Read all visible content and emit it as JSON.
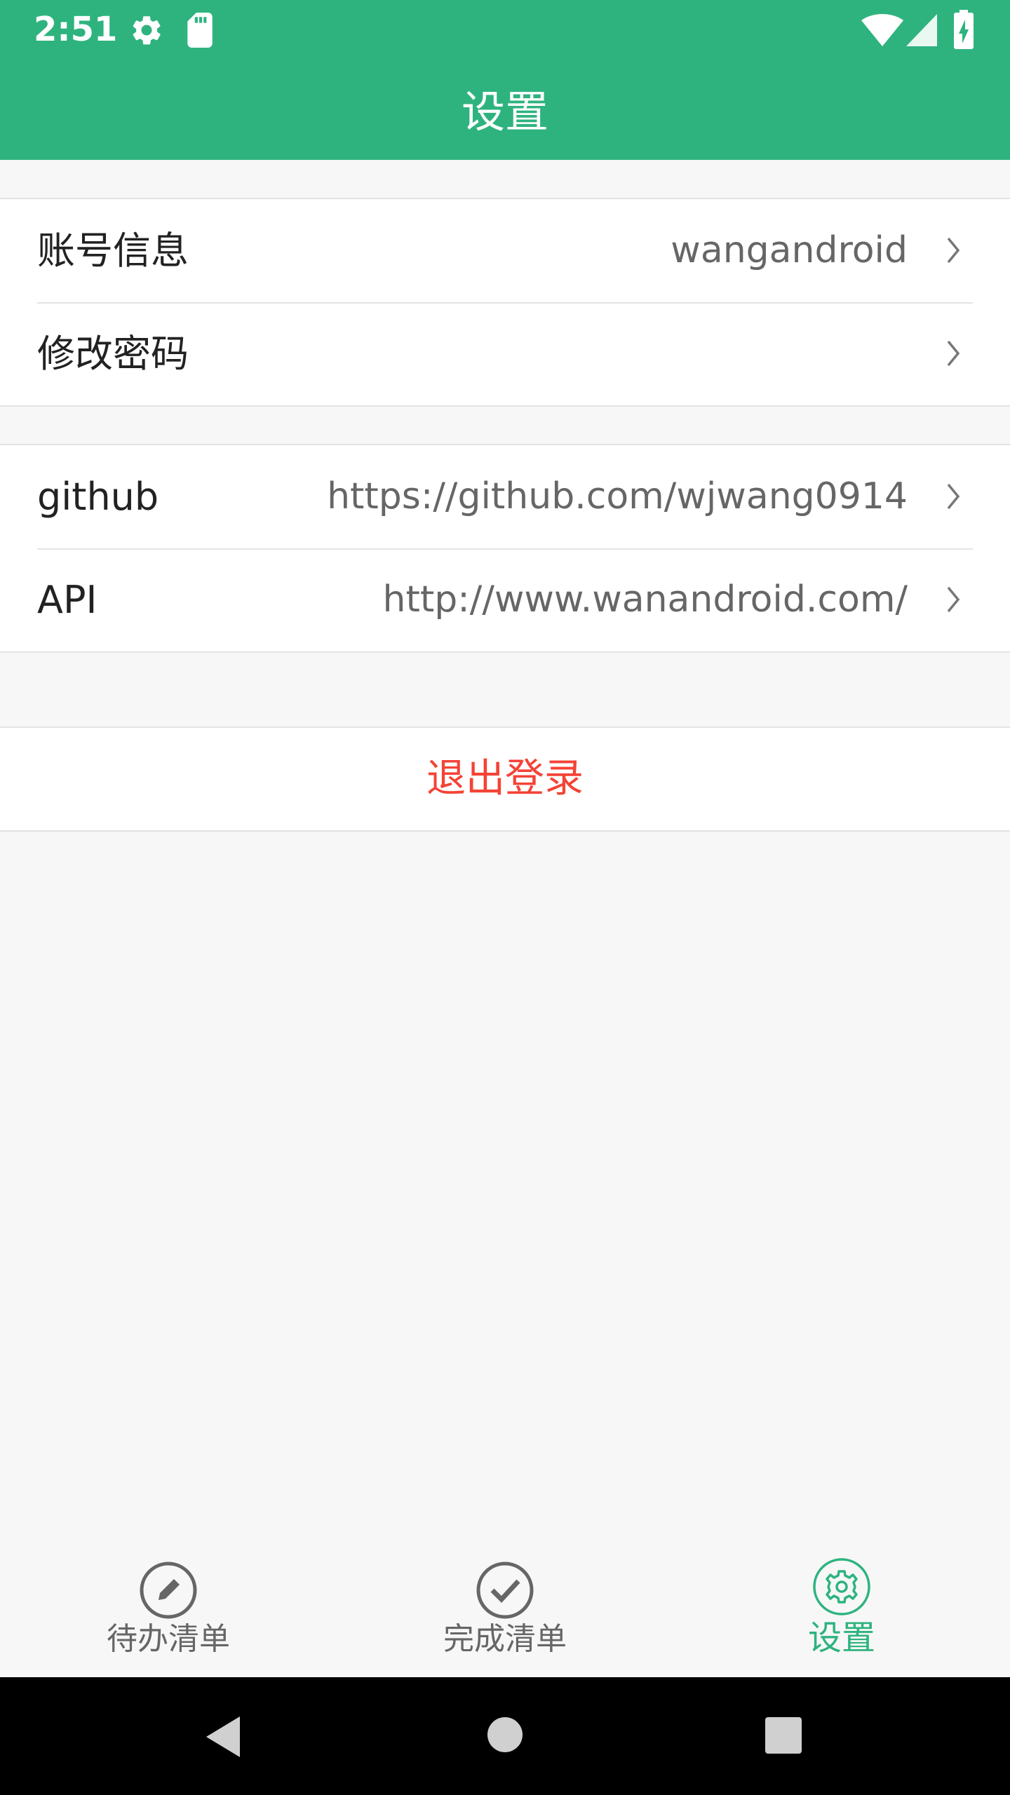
{
  "status_bar": {
    "time": "2:51",
    "icons": [
      "settings-gear-icon",
      "sd-card-icon",
      "wifi-icon",
      "cell-signal-icon",
      "battery-charging-icon"
    ]
  },
  "toolbar": {
    "title": "设置"
  },
  "account_group": {
    "items": [
      {
        "label": "账号信息",
        "value": "wangandroid"
      },
      {
        "label": "修改密码",
        "value": ""
      }
    ]
  },
  "links_group": {
    "items": [
      {
        "label": "github",
        "value": "https://github.com/wjwang0914"
      },
      {
        "label": "API",
        "value": "http://www.wanandroid.com/"
      }
    ]
  },
  "logout": {
    "label": "退出登录"
  },
  "bottom_nav": {
    "items": [
      {
        "label": "待办清单",
        "icon": "pencil-circle-icon",
        "active": false
      },
      {
        "label": "完成清单",
        "icon": "check-circle-icon",
        "active": false
      },
      {
        "label": "设置",
        "icon": "gear-circle-icon",
        "active": true
      }
    ]
  },
  "system_nav": {
    "icons": [
      "back-icon",
      "home-icon",
      "recents-icon"
    ]
  },
  "colors": {
    "primary": "#2eb37f",
    "logout_red": "#f44336",
    "text_dark": "#222222",
    "text_secondary": "#666666",
    "background": "#f7f7f7"
  }
}
